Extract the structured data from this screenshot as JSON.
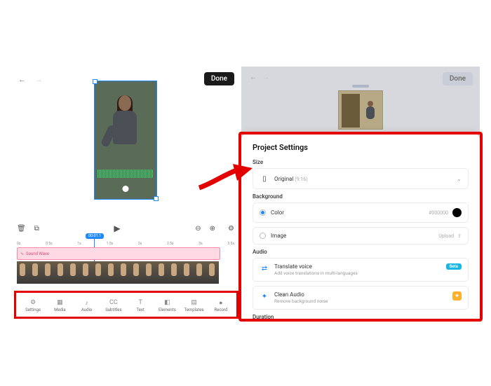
{
  "left": {
    "done": "Done",
    "ruler": [
      "0s",
      "0.5s",
      "1s",
      "1.5s",
      "2s",
      "2.5s",
      "3s",
      "3.5s"
    ],
    "playhead_time": "00:01.1",
    "sound_track_label": "Sound Wave",
    "bottom_tabs": [
      {
        "icon": "⚙",
        "label": "Settings"
      },
      {
        "icon": "▦",
        "label": "Media"
      },
      {
        "icon": "♪",
        "label": "Audio"
      },
      {
        "icon": "CC",
        "label": "Subtitles"
      },
      {
        "icon": "T",
        "label": "Text"
      },
      {
        "icon": "◧",
        "label": "Elements"
      },
      {
        "icon": "▤",
        "label": "Templates"
      },
      {
        "icon": "●",
        "label": "Record"
      }
    ]
  },
  "right": {
    "done": "Done",
    "sheet_title": "Project Settings",
    "size_label": "Size",
    "size_value": "Original",
    "size_ratio": "(9:16)",
    "bg_label": "Background",
    "bg_color_label": "Color",
    "bg_color_value": "#000000",
    "bg_image_label": "Image",
    "bg_image_action": "Upload",
    "audio_label": "Audio",
    "translate_title": "Translate voice",
    "translate_sub": "Add voice translations in multi-languages",
    "translate_badge": "Beta",
    "clean_title": "Clean Audio",
    "clean_sub": "Remove background noise",
    "duration_label": "Duration"
  }
}
